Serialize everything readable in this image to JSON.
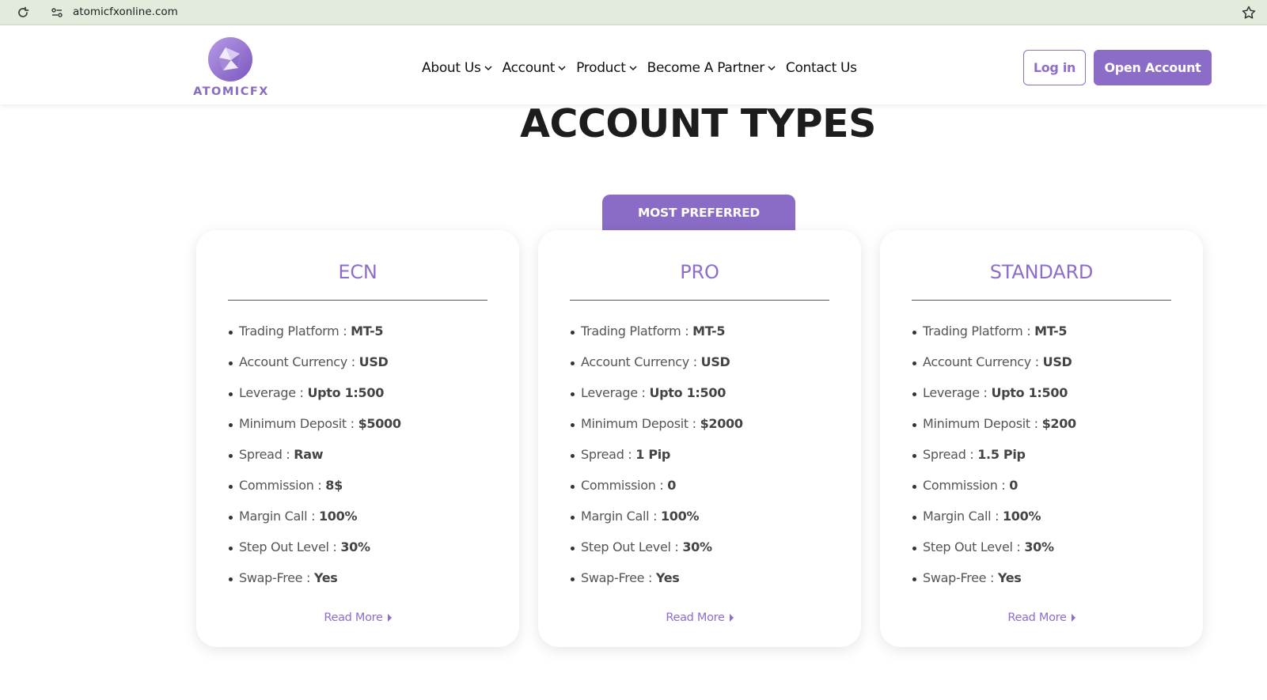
{
  "browser": {
    "url": "atomicfxonline.com"
  },
  "header": {
    "logo_text": "ATOMICFX",
    "nav": [
      {
        "label": "About Us",
        "has_dropdown": true
      },
      {
        "label": "Account",
        "has_dropdown": true
      },
      {
        "label": "Product",
        "has_dropdown": true
      },
      {
        "label": "Become A Partner",
        "has_dropdown": true
      },
      {
        "label": "Contact Us",
        "has_dropdown": false
      }
    ],
    "login_label": "Log in",
    "open_account_label": "Open Account"
  },
  "main": {
    "title": "ACCOUNT TYPES",
    "ribbon_label": "MOST PREFERRED",
    "read_more_label": "Read More",
    "cards": [
      {
        "name": "ECN",
        "features": [
          {
            "label": "Trading Platform : ",
            "value": "MT-5"
          },
          {
            "label": "Account Currency : ",
            "value": "USD"
          },
          {
            "label": "Leverage : ",
            "value": "Upto 1:500"
          },
          {
            "label": "Minimum Deposit : ",
            "value": "$5000"
          },
          {
            "label": "Spread : ",
            "value": "Raw"
          },
          {
            "label": "Commission : ",
            "value": "8$"
          },
          {
            "label": "Margin Call : ",
            "value": "100%"
          },
          {
            "label": "Step Out Level : ",
            "value": "30%"
          },
          {
            "label": "Swap-Free : ",
            "value": "Yes"
          }
        ]
      },
      {
        "name": "PRO",
        "features": [
          {
            "label": "Trading Platform : ",
            "value": "MT-5"
          },
          {
            "label": "Account Currency : ",
            "value": "USD"
          },
          {
            "label": "Leverage : ",
            "value": "Upto 1:500"
          },
          {
            "label": "Minimum Deposit : ",
            "value": "$2000"
          },
          {
            "label": "Spread : ",
            "value": "1 Pip"
          },
          {
            "label": "Commission : ",
            "value": "0"
          },
          {
            "label": "Margin Call : ",
            "value": "100%"
          },
          {
            "label": "Step Out Level : ",
            "value": "30%"
          },
          {
            "label": "Swap-Free : ",
            "value": "Yes"
          }
        ]
      },
      {
        "name": "STANDARD",
        "features": [
          {
            "label": "Trading Platform : ",
            "value": "MT-5"
          },
          {
            "label": "Account Currency : ",
            "value": "USD"
          },
          {
            "label": "Leverage : ",
            "value": "Upto 1:500"
          },
          {
            "label": "Minimum Deposit : ",
            "value": "$200"
          },
          {
            "label": "Spread : ",
            "value": "1.5 Pip"
          },
          {
            "label": "Commission : ",
            "value": "0"
          },
          {
            "label": "Margin Call : ",
            "value": "100%"
          },
          {
            "label": "Step Out Level : ",
            "value": "30%"
          },
          {
            "label": "Swap-Free : ",
            "value": "Yes"
          }
        ]
      }
    ]
  },
  "colors": {
    "brand": "#8b6cc7",
    "browser_bar": "#e3ebdd",
    "heading": "#1d1d1d"
  },
  "icons": [
    "reload-icon",
    "site-info-icon",
    "bookmark-star-icon",
    "chevron-down-icon",
    "caret-right-icon"
  ]
}
